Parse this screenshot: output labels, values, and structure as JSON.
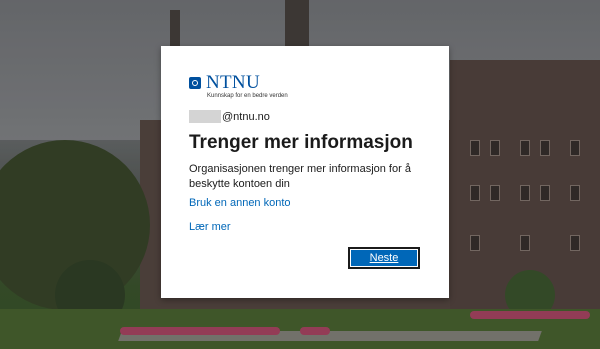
{
  "org": {
    "logo_text": "NTNU",
    "tagline": "Kunnskap for en bedre verden"
  },
  "identity": {
    "email_suffix": "@ntnu.no"
  },
  "page": {
    "title": "Trenger mer informasjon",
    "description": "Organisasjonen trenger mer informasjon for å beskytte kontoen din"
  },
  "links": {
    "other_account": "Bruk en annen konto",
    "learn_more": "Lær mer"
  },
  "buttons": {
    "next": "Neste"
  },
  "colors": {
    "accent": "#0067b8",
    "brand": "#00509e"
  },
  "icons": {
    "logo": "ntnu-logo-icon"
  }
}
